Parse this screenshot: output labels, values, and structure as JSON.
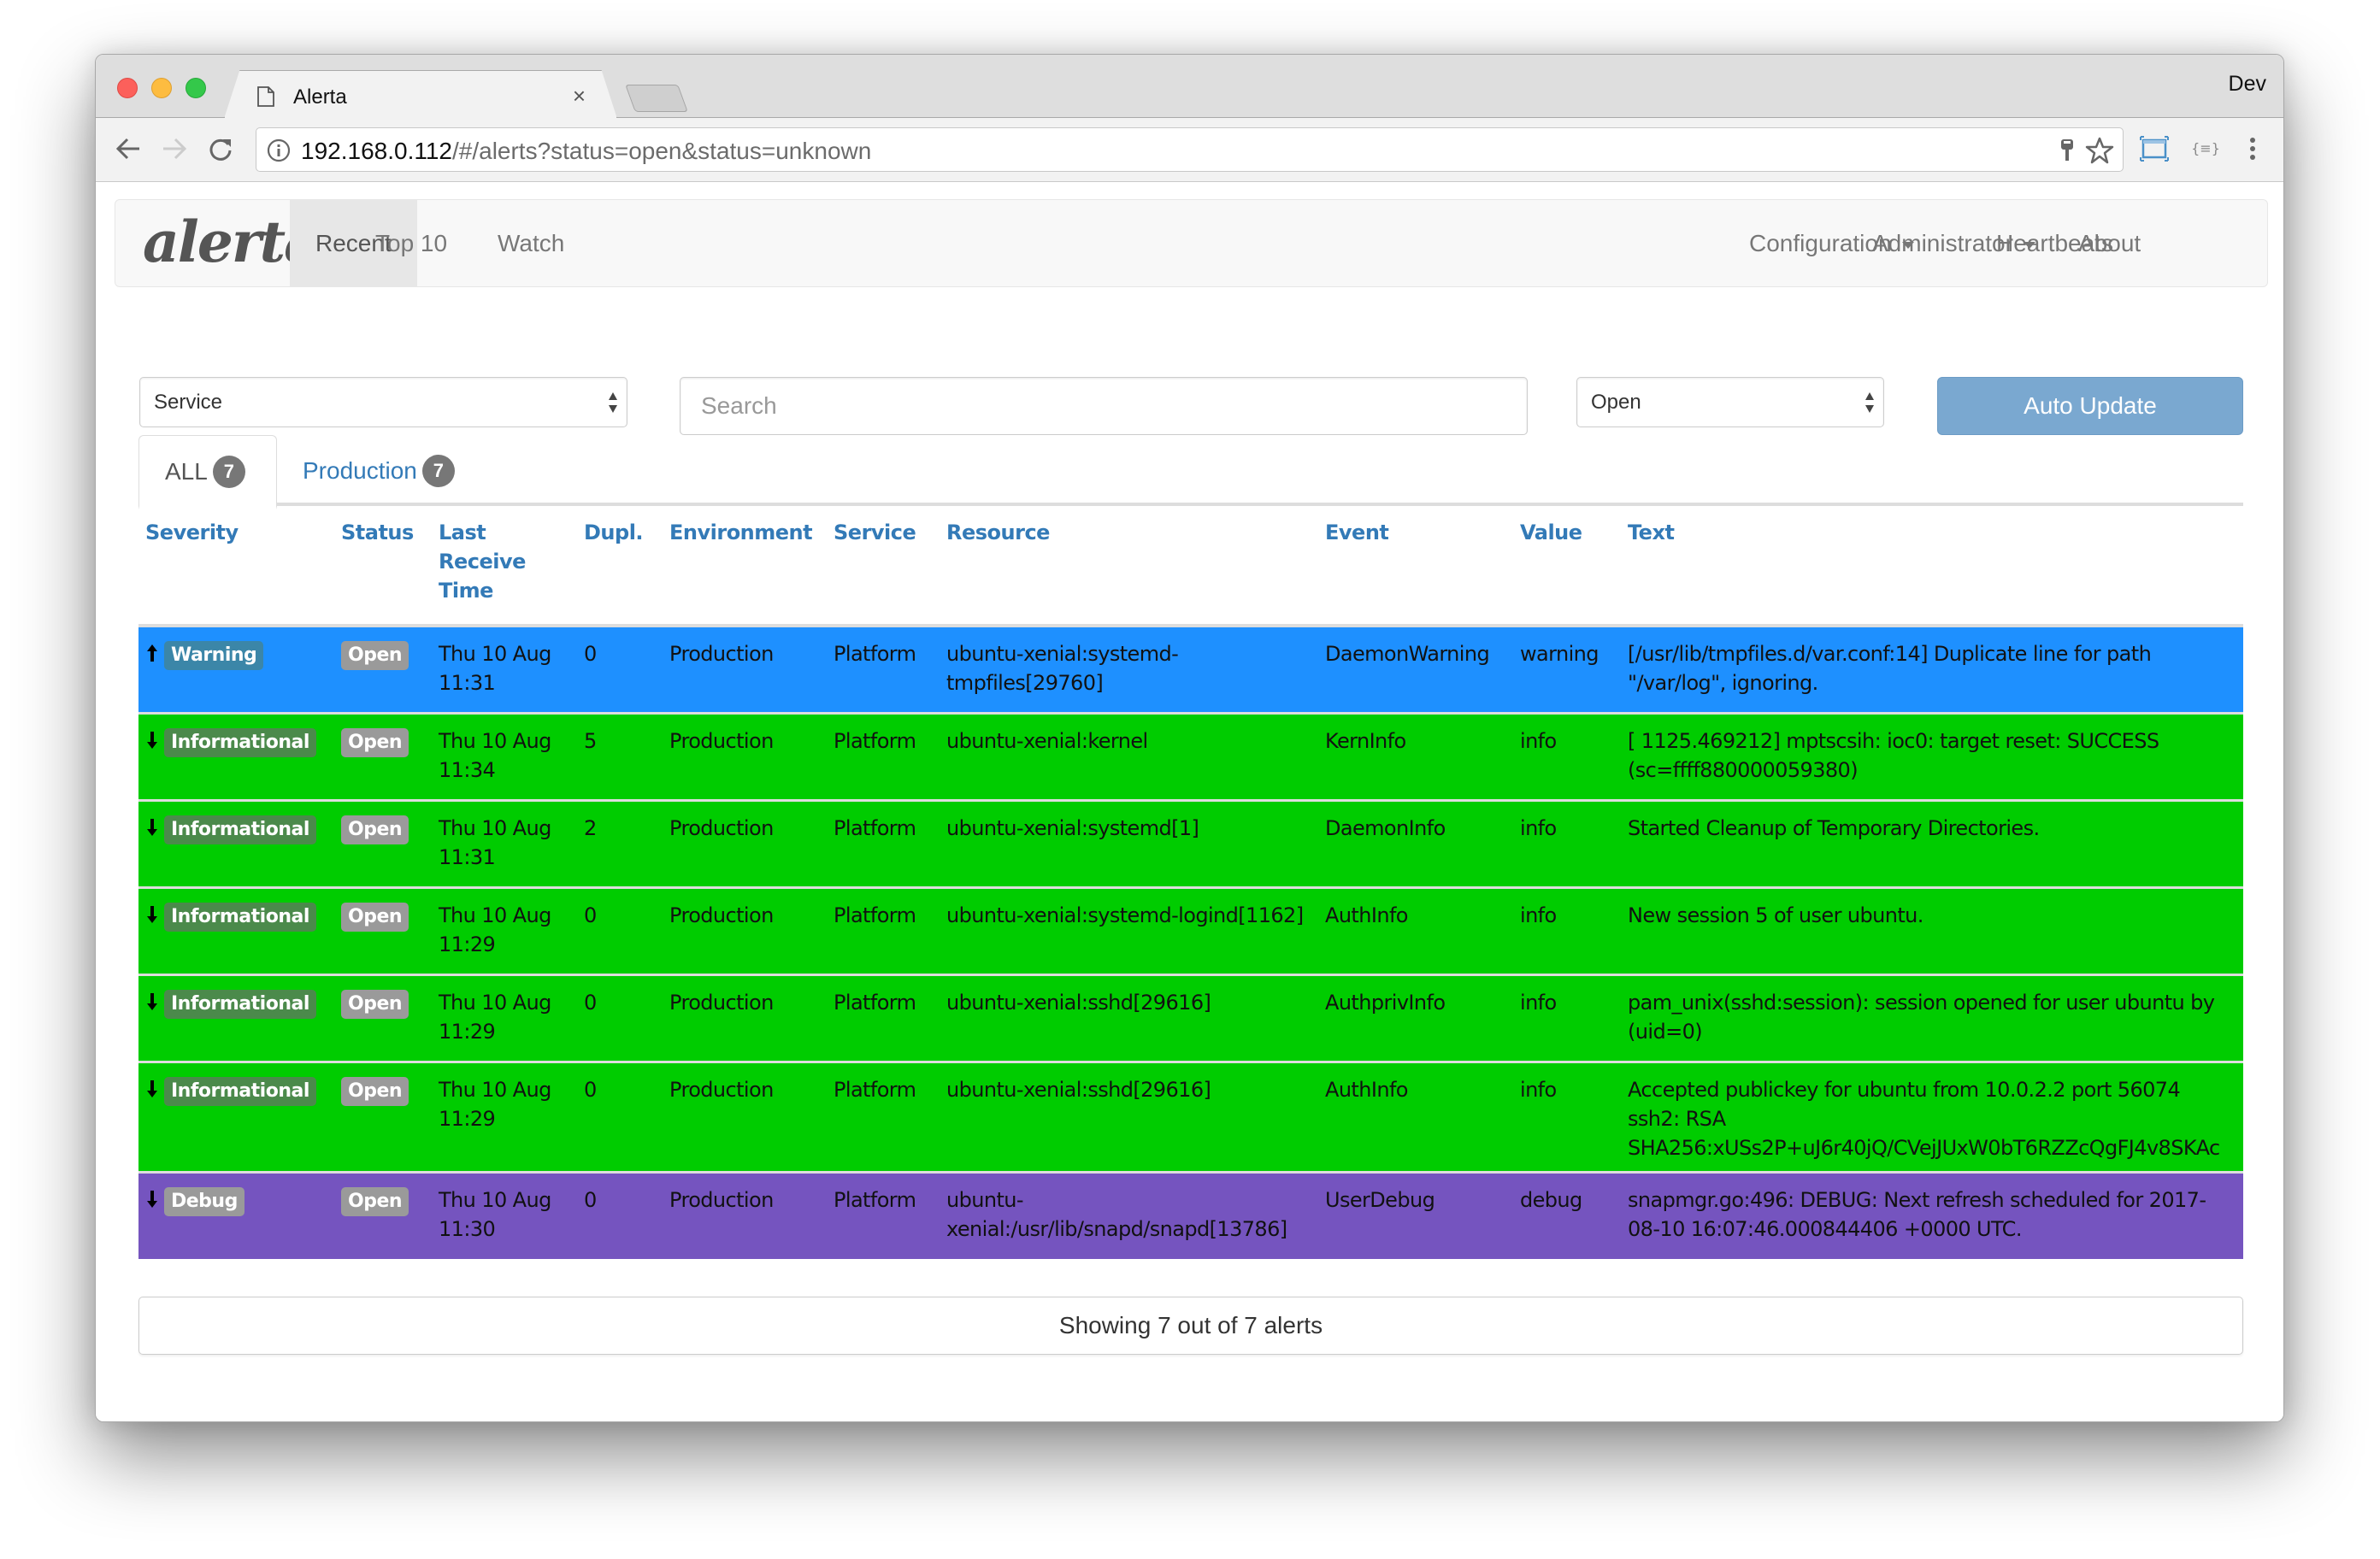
{
  "browser": {
    "tab_title": "Alerta",
    "tab_close": "×",
    "profile_name": "Dev",
    "url_host": "192.168.0.112",
    "url_path": "/#/alerts?status=open&status=unknown"
  },
  "navbar": {
    "brand": "alerta",
    "links": [
      {
        "label": "Recent",
        "active": true
      },
      {
        "label": "Top 10"
      },
      {
        "label": "Watch"
      }
    ],
    "right_links": [
      {
        "label": "Configuration",
        "dropdown": true
      },
      {
        "label": "Administrator",
        "dropdown": true
      },
      {
        "label": "Heartbeats"
      },
      {
        "label": "About"
      }
    ]
  },
  "filters": {
    "service_select": "Service",
    "search_placeholder": "Search",
    "status_select": "Open",
    "auto_update_label": "Auto Update"
  },
  "env_tabs": [
    {
      "label": "ALL",
      "count": "7",
      "active": true
    },
    {
      "label": "Production",
      "count": "7"
    }
  ],
  "table": {
    "columns": [
      "Severity",
      "Status",
      "Last Receive Time",
      "Dupl.",
      "Environment",
      "Service",
      "Resource",
      "Event",
      "Value",
      "Text"
    ],
    "rows": [
      {
        "direction": "up",
        "severity": "Warning",
        "status": "Open",
        "time_date": "Thu 10 Aug",
        "time_hm": "11:31",
        "dupl": "0",
        "environment": "Production",
        "service": "Platform",
        "resource": "ubuntu-xenial:systemd-tmpfiles[29760]",
        "event": "DaemonWarning",
        "value": "warning",
        "text": "[/usr/lib/tmpfiles.d/var.conf:14] Duplicate line for path \"/var/log\", ignoring."
      },
      {
        "direction": "down",
        "severity": "Informational",
        "status": "Open",
        "time_date": "Thu 10 Aug",
        "time_hm": "11:34",
        "dupl": "5",
        "environment": "Production",
        "service": "Platform",
        "resource": "ubuntu-xenial:kernel",
        "event": "KernInfo",
        "value": "info",
        "text": "[ 1125.469212] mptscsih: ioc0: target reset: SUCCESS (sc=ffff880000059380)"
      },
      {
        "direction": "down",
        "severity": "Informational",
        "status": "Open",
        "time_date": "Thu 10 Aug",
        "time_hm": "11:31",
        "dupl": "2",
        "environment": "Production",
        "service": "Platform",
        "resource": "ubuntu-xenial:systemd[1]",
        "event": "DaemonInfo",
        "value": "info",
        "text": "Started Cleanup of Temporary Directories."
      },
      {
        "direction": "down",
        "severity": "Informational",
        "status": "Open",
        "time_date": "Thu 10 Aug",
        "time_hm": "11:29",
        "dupl": "0",
        "environment": "Production",
        "service": "Platform",
        "resource": "ubuntu-xenial:systemd-logind[1162]",
        "event": "AuthInfo",
        "value": "info",
        "text": "New session 5 of user ubuntu."
      },
      {
        "direction": "down",
        "severity": "Informational",
        "status": "Open",
        "time_date": "Thu 10 Aug",
        "time_hm": "11:29",
        "dupl": "0",
        "environment": "Production",
        "service": "Platform",
        "resource": "ubuntu-xenial:sshd[29616]",
        "event": "AuthprivInfo",
        "value": "info",
        "text": "pam_unix(sshd:session): session opened for user ubuntu by (uid=0)"
      },
      {
        "direction": "down",
        "severity": "Informational",
        "status": "Open",
        "time_date": "Thu 10 Aug",
        "time_hm": "11:29",
        "dupl": "0",
        "environment": "Production",
        "service": "Platform",
        "resource": "ubuntu-xenial:sshd[29616]",
        "event": "AuthInfo",
        "value": "info",
        "text": "Accepted publickey for ubuntu from 10.0.2.2 port 56074 ssh2: RSA SHA256:xUSs2P+uJ6r40jQ/CVejJUxW0bT6RZZcQgFJ4v8SKAc"
      },
      {
        "direction": "down",
        "severity": "Debug",
        "status": "Open",
        "time_date": "Thu 10 Aug",
        "time_hm": "11:30",
        "dupl": "0",
        "environment": "Production",
        "service": "Platform",
        "resource": "ubuntu-xenial:/usr/lib/snapd/snapd[13786]",
        "event": "UserDebug",
        "value": "debug",
        "text": "snapmgr.go:496: DEBUG: Next refresh scheduled for 2017-08-10 16:07:46.000844406 +0000 UTC."
      }
    ]
  },
  "footer": {
    "summary": "Showing 7 out of 7 alerts"
  },
  "colors": {
    "warning_row": "#1e90ff",
    "informational_row": "#00cc00",
    "debug_row": "#7554bf",
    "link_blue": "#337ab7",
    "auto_update_button": "#7aa8d0"
  }
}
